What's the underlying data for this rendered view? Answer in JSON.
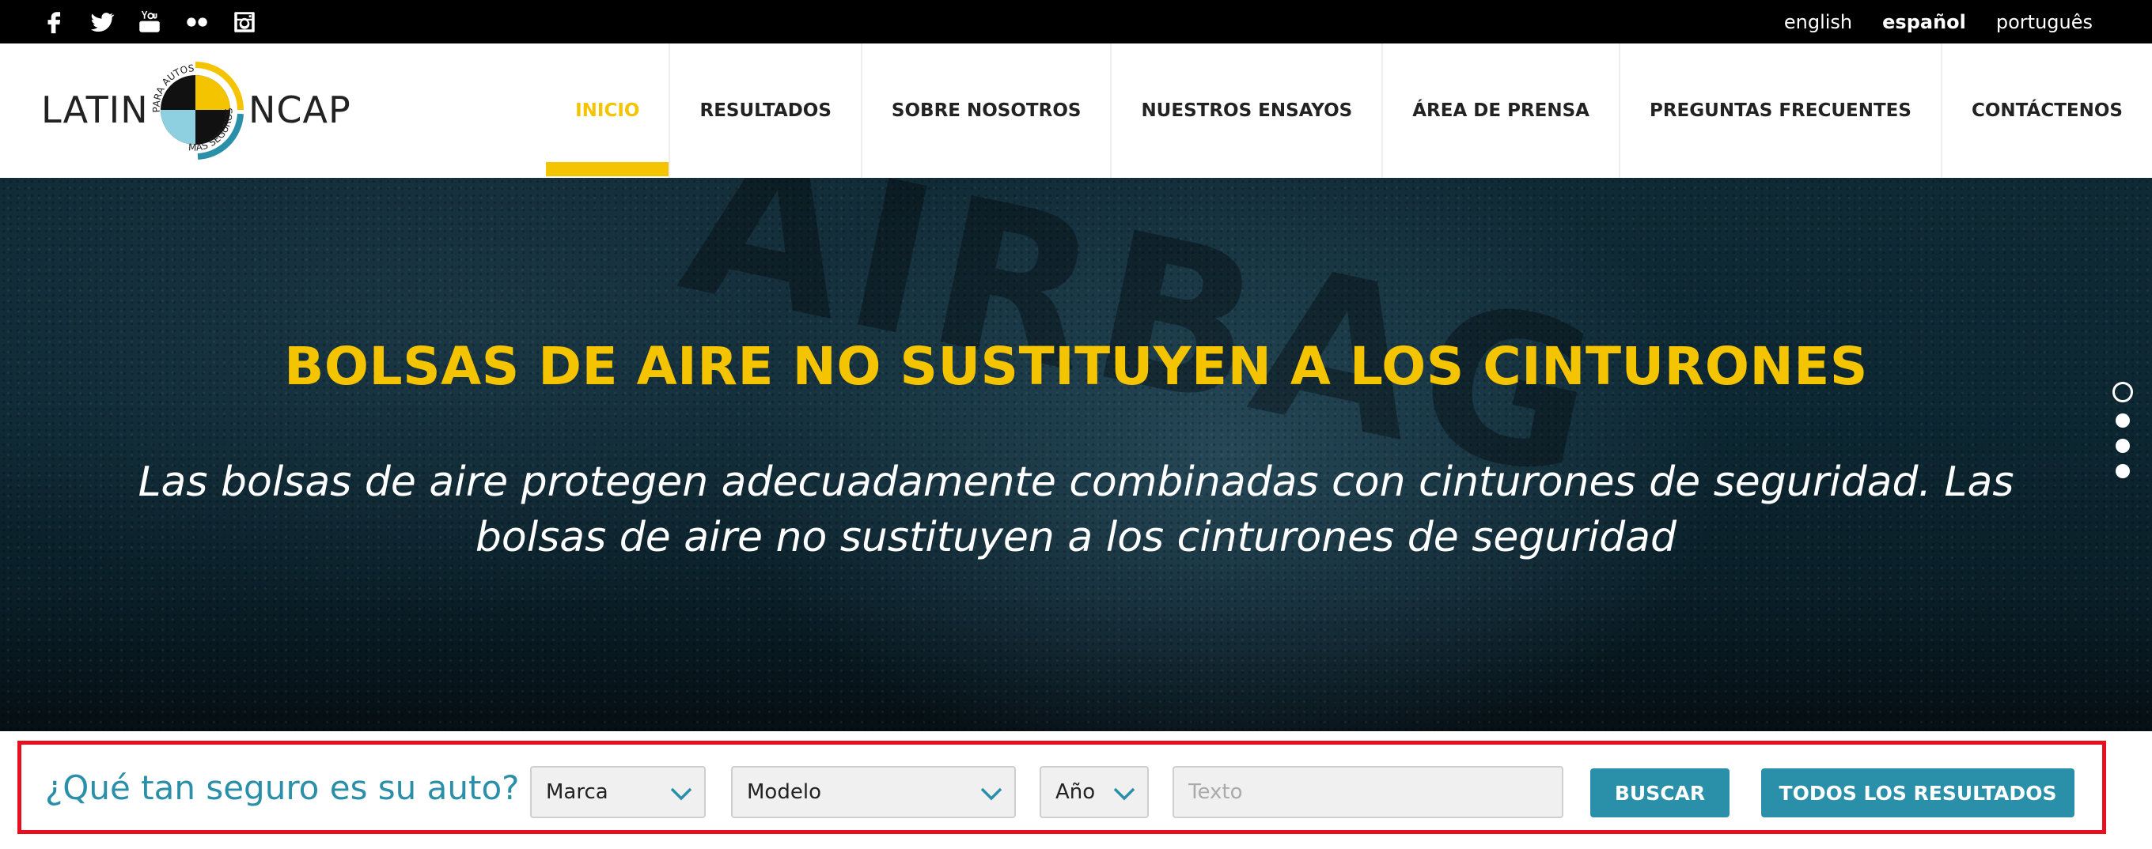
{
  "topbar": {
    "social": [
      "facebook-icon",
      "twitter-icon",
      "youtube-icon",
      "flickr-icon",
      "instagram-icon"
    ],
    "youtube_text": "You\nTube",
    "languages": [
      {
        "label": "english",
        "active": false
      },
      {
        "label": "español",
        "active": true
      },
      {
        "label": "português",
        "active": false
      }
    ]
  },
  "header": {
    "logo": {
      "left": "LATIN",
      "right": "NCAP",
      "ring_top": "PARA AUTOS",
      "ring_bottom": "MÁS SEGUROS"
    },
    "nav": [
      {
        "label": "INICIO",
        "active": true
      },
      {
        "label": "RESULTADOS",
        "active": false
      },
      {
        "label": "SOBRE NOSOTROS",
        "active": false
      },
      {
        "label": "NUESTROS ENSAYOS",
        "active": false
      },
      {
        "label": "ÁREA DE PRENSA",
        "active": false
      },
      {
        "label": "PREGUNTAS FRECUENTES",
        "active": false
      },
      {
        "label": "CONTÁCTENOS",
        "active": false
      }
    ]
  },
  "hero": {
    "background_word": "AIRBAG",
    "title": "BOLSAS DE AIRE NO SUSTITUYEN A LOS CINTURONES",
    "subtitle": "Las bolsas de aire protegen adecuadamente combinadas con cinturones de seguridad. Las bolsas de aire no sustituyen a los cinturones de seguridad",
    "slide_count": 4,
    "active_slide": 1
  },
  "search": {
    "label": "¿Qué tan seguro es su auto?",
    "marca": "Marca",
    "modelo": "Modelo",
    "ano": "Año",
    "text_placeholder": "Texto",
    "buscar_label": "BUSCAR",
    "todos_label": "TODOS LOS RESULTADOS"
  },
  "colors": {
    "accent_yellow": "#f5c400",
    "accent_teal": "#2a8fa8",
    "highlight_red": "#e8101e"
  }
}
